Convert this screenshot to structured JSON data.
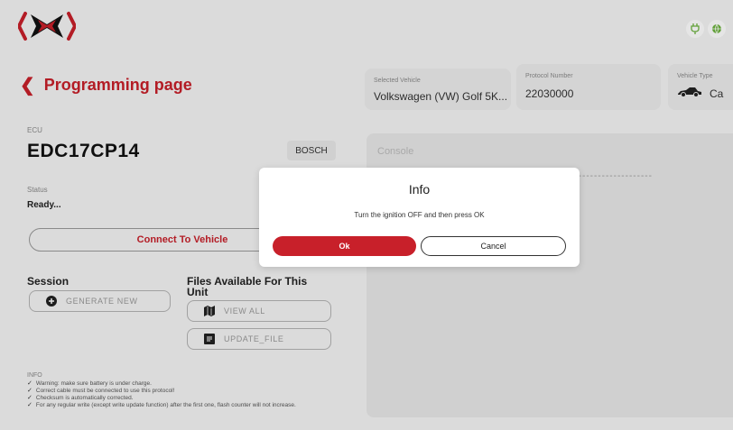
{
  "header": {
    "logo_icon": "bracket-x-logo",
    "status_icons": [
      "plug-icon",
      "globe-icon"
    ]
  },
  "page": {
    "back_label": "Programming page"
  },
  "vehicle_info": {
    "selected_vehicle_label": "Selected Vehicle",
    "selected_vehicle_value": "Volkswagen (VW) Golf 5K...",
    "protocol_label": "Protocol Number",
    "protocol_value": "22030000",
    "vehicle_type_label": "Vehicle Type",
    "vehicle_type_value": "Ca"
  },
  "ecu": {
    "label": "ECU",
    "name": "EDC17CP14",
    "brand": "BOSCH",
    "status_label": "Status",
    "status_value": "Ready...",
    "connect_label": "Connect To Vehicle"
  },
  "session": {
    "title": "Session",
    "generate_label": "GENERATE NEW"
  },
  "files": {
    "title": "Files Available For This Unit",
    "view_all_label": "VIEW ALL",
    "update_file_label": "UPDATE_FILE"
  },
  "info": {
    "title": "INFO",
    "items": [
      "Warning: make sure battery is under charge.",
      "Correct cable must be connected to use this protocol!",
      "Checksum is automatically corrected.",
      "For any regular write (except write update function) after the first one, flash counter will not increase."
    ]
  },
  "console": {
    "title": "Console",
    "dashes": "---------------------"
  },
  "modal": {
    "title": "Info",
    "message": "Turn the ignition OFF and then press OK",
    "ok_label": "Ok",
    "cancel_label": "Cancel"
  },
  "colors": {
    "accent": "#c8202a",
    "background": "#f4f4f4",
    "card": "#ececec"
  }
}
